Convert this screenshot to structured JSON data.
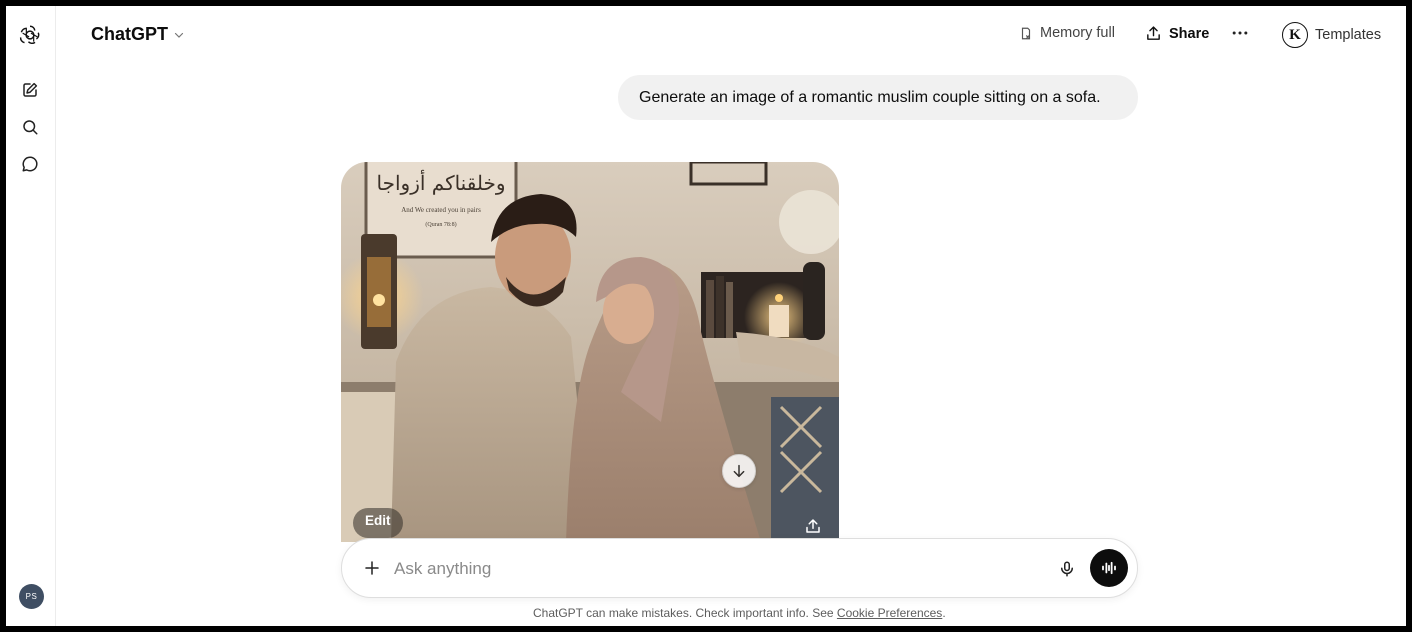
{
  "header": {
    "model_name": "ChatGPT",
    "memory_label": "Memory full",
    "share_label": "Share",
    "profile_initial": "K",
    "templates_label": "Templates"
  },
  "sidebar": {
    "icons": [
      "openai-logo-icon",
      "new-chat-icon",
      "search-icon",
      "chat-bubble-icon"
    ],
    "avatar_initials": "PS",
    "avatar_color": "#3f4e63"
  },
  "conversation": {
    "user_message": "Generate an image of a romantic muslim couple sitting on a sofa.",
    "image": {
      "edit_label": "Edit",
      "calligraphy_line1": "وخلقناكم أزواجا",
      "caption_line1": "And We created you in pairs",
      "caption_line2": "(Quran 78:8)"
    }
  },
  "composer": {
    "placeholder": "Ask anything"
  },
  "footer": {
    "disclaimer_text": "ChatGPT can make mistakes. Check important info. See ",
    "cookie_link": "Cookie Preferences",
    "disclaimer_end": "."
  },
  "colors": {
    "bubble_bg": "#f1f1f1",
    "voice_button_bg": "#0d0d0d"
  }
}
